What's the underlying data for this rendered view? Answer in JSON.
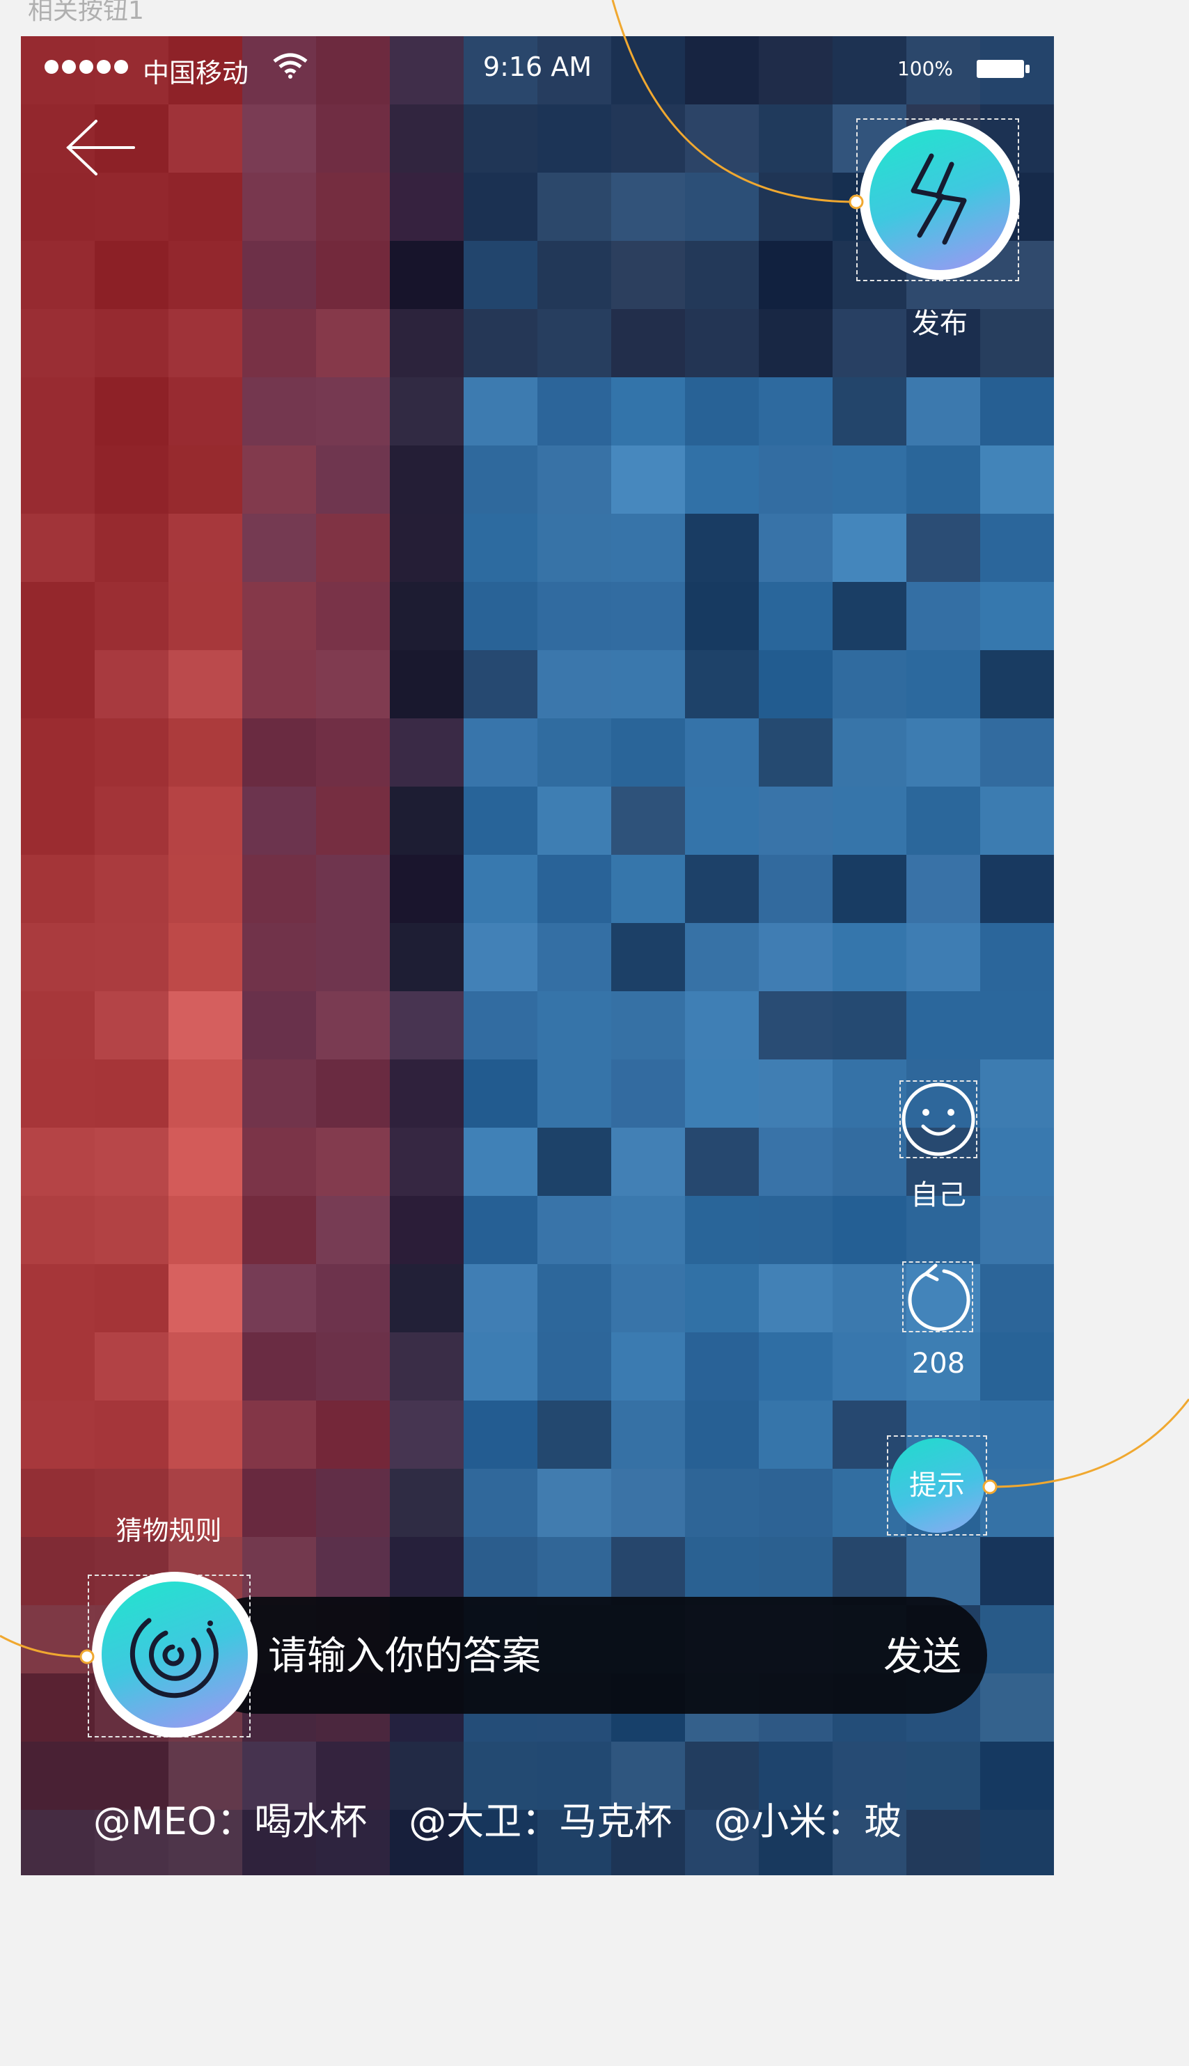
{
  "artboard": {
    "label": "相关按钮1"
  },
  "status_bar": {
    "carrier": "中国移动",
    "time": "9:16 AM",
    "battery": "100%"
  },
  "publish": {
    "label": "发布",
    "icon": "lightning-icon"
  },
  "side": {
    "self_label": "自己",
    "refresh_count": "208",
    "hint_label": "提示"
  },
  "rules": {
    "label": "猜物规则",
    "icon": "swirl-icon"
  },
  "answer": {
    "placeholder": "请输入你的答案",
    "send_label": "发送"
  },
  "comments": [
    {
      "user": "@MEO",
      "answer": "喝水杯"
    },
    {
      "user": "@大卫",
      "answer": "马克杯"
    },
    {
      "user": "@小米",
      "answer": "玻"
    }
  ],
  "colors": {
    "accent_gradient_start": "#20e6cc",
    "accent_gradient_end": "#a493f4",
    "connector": "#f0a830"
  }
}
